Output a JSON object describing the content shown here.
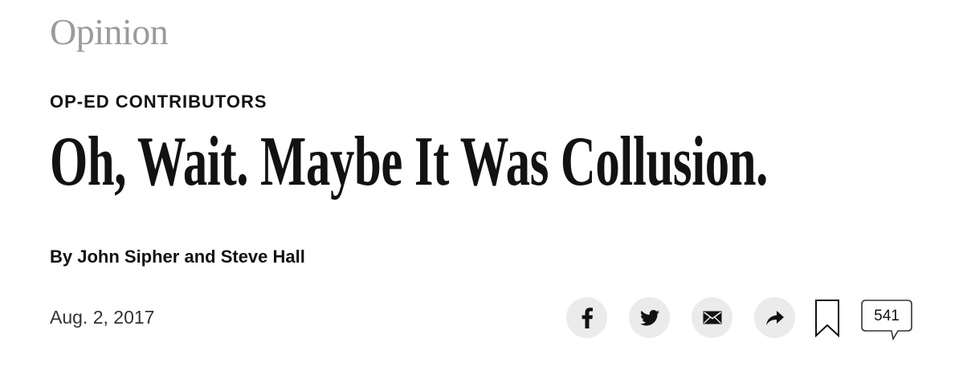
{
  "section": {
    "label": "Opinion"
  },
  "article": {
    "kicker": "OP-ED CONTRIBUTORS",
    "headline": "Oh, Wait. Maybe It Was Collusion.",
    "byline": "By John Sipher and Steve Hall",
    "date": "Aug. 2, 2017"
  },
  "share": {
    "buttons": [
      {
        "icon": "facebook-icon"
      },
      {
        "icon": "twitter-icon"
      },
      {
        "icon": "email-icon"
      },
      {
        "icon": "share-arrow-icon"
      },
      {
        "icon": "bookmark-icon"
      }
    ],
    "comment_count": "541"
  },
  "colors": {
    "text": "#121212",
    "section_gray": "#9b9b9b",
    "button_bg": "#ebebeb"
  }
}
